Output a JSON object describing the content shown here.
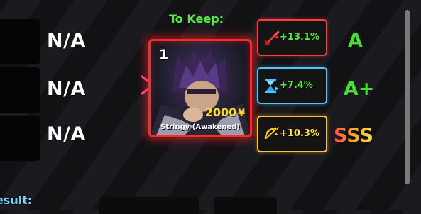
{
  "left_slots": [
    {
      "label": "N/A"
    },
    {
      "label": "N/A"
    },
    {
      "label": "N/A"
    }
  ],
  "to_keep": {
    "title": "To Keep:",
    "unit": {
      "number": "1",
      "cost": "2000",
      "currency_icon": "yen-icon",
      "name": "Stringy (Awakened)",
      "border_color": "#ff2929"
    }
  },
  "stats": [
    {
      "icon": "sword-damage-icon",
      "value": "+13.1%",
      "grade": "A",
      "border_color": "#ff3b3b",
      "value_color": "#5ee34c",
      "grade_color": "#44e038"
    },
    {
      "icon": "hourglass-cooldown-icon",
      "value": "+7.4%",
      "grade": "A+",
      "border_color": "#4dc6ff",
      "value_color": "#5ee34c",
      "grade_color": "#44e038"
    },
    {
      "icon": "crosshair-range-icon",
      "value": "+10.3%",
      "grade": "SSS",
      "border_color": "#ffc12b",
      "value_color": "#ffe04a",
      "grade_color": "gradient"
    }
  ],
  "result": {
    "label": "esult:"
  }
}
